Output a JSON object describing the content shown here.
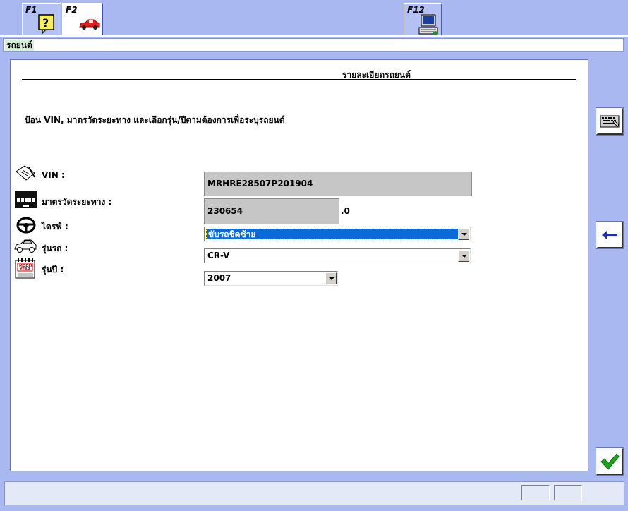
{
  "toolbar": {
    "f1": {
      "key": "F1",
      "icon": "help-icon"
    },
    "f2": {
      "key": "F2",
      "icon": "car-icon"
    },
    "f12": {
      "key": "F12",
      "icon": "computer-icon"
    }
  },
  "breadcrumb": "รถยนต์",
  "panel": {
    "title": "รายละเอียดรถยนต์",
    "instruction": "ป้อน VIN, มาตรวัดระยะทาง และเลือกรุ่น/ปีตามต้องการเพื่อระบุรถยนต์"
  },
  "form": {
    "vin": {
      "label": "VIN :",
      "value": "MRHRE28507P201904",
      "icon": "vin-document-icon"
    },
    "odometer": {
      "label": "มาตรวัดระยะทาง :",
      "value": "230654",
      "suffix": ".0",
      "icon": "odometer-icon"
    },
    "drive": {
      "label": "ไดรฟ์ :",
      "value": "ขับรถชิดซ้าย",
      "icon": "steering-wheel-icon"
    },
    "model": {
      "label": "รุ่นรถ :",
      "value": "CR-V",
      "icon": "car-model-icon"
    },
    "year": {
      "label": "รุ่นปี :",
      "value": "2007",
      "icon": "model-year-calendar-icon"
    }
  },
  "side_buttons": {
    "keyboard": "keyboard-icon",
    "back": "back-arrow-icon",
    "confirm": "checkmark-icon"
  },
  "colors": {
    "background": "#a9b8f0",
    "selection": "#0a6ad8",
    "confirm_green": "#1aa81a"
  }
}
